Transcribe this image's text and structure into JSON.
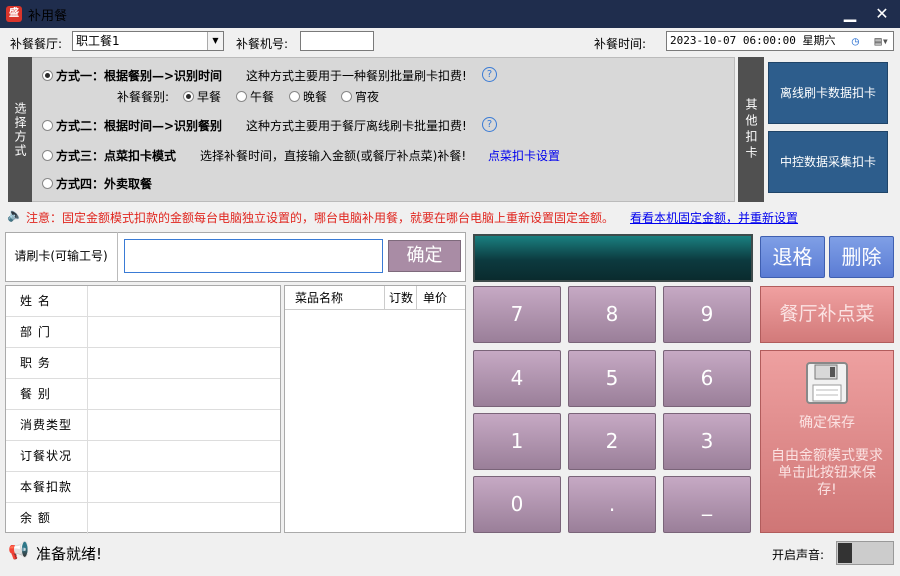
{
  "window": {
    "title": "补用餐",
    "min": "▁",
    "close": "✕"
  },
  "top": {
    "canteen_label": "补餐餐厅:",
    "canteen_value": "职工餐1",
    "machine_label": "补餐机号:",
    "machine_value": "",
    "time_label": "补餐时间:",
    "time_value": "2023-10-07 06:00:00 星期六"
  },
  "options": {
    "side_label": "选择方式",
    "mode1_title": "方式一：根据餐别—>识别时间",
    "mode1_desc": "这种方式主要用于一种餐别批量刷卡扣费!",
    "meal_type_label": "补餐餐别:",
    "meals": [
      "早餐",
      "午餐",
      "晚餐",
      "宵夜"
    ],
    "mode2_title": "方式二：根据时间—>识别餐别",
    "mode2_desc": "这种方式主要用于餐厅离线刷卡批量扣费!",
    "mode3_title": "方式三：点菜扣卡模式",
    "mode3_desc": "选择补餐时间，直接输入金额(或餐厅补点菜)补餐!",
    "mode3_link": "点菜扣卡设置",
    "mode4_title": "方式四：外卖取餐",
    "help": "?"
  },
  "other": {
    "side_label": "其他扣卡",
    "offline_btn": "离线刷卡数据扣卡",
    "central_btn": "中控数据采集扣卡"
  },
  "notice": {
    "text": "注意：固定金额模式扣款的金额每台电脑独立设置的，哪台电脑补用餐，就要在哪台电脑上重新设置固定金额。",
    "link": "看看本机固定金额，并重新设置"
  },
  "card": {
    "label": "请刷卡(可输工号)",
    "input_value": "",
    "ok_btn": "确定"
  },
  "info": {
    "rows": [
      "姓    名",
      "部    门",
      "职    务",
      "餐    别",
      "消费类型",
      "订餐状况",
      "本餐扣款",
      "余    额"
    ]
  },
  "dishes": {
    "headers": [
      "菜品名称",
      "订数",
      "单价"
    ]
  },
  "display": {
    "value": ""
  },
  "keypad": {
    "keys": [
      "7",
      "8",
      "9",
      "4",
      "5",
      "6",
      "1",
      "2",
      "3",
      "0",
      ".",
      "_"
    ],
    "backspace": "退格",
    "delete": "删除",
    "meal_btn": "餐厅补点菜",
    "save_btn": "确定保存",
    "save_hint": "自由金额模式要求单击此按钮来保存!"
  },
  "status": {
    "ready": "准备就绪!",
    "sound_label": "开启声音:"
  },
  "colors": {
    "titlebar": "#1f2d4d",
    "accent_blue": "#2d5d8c",
    "keypad": "#b497b2",
    "warning": "#e0261f"
  }
}
